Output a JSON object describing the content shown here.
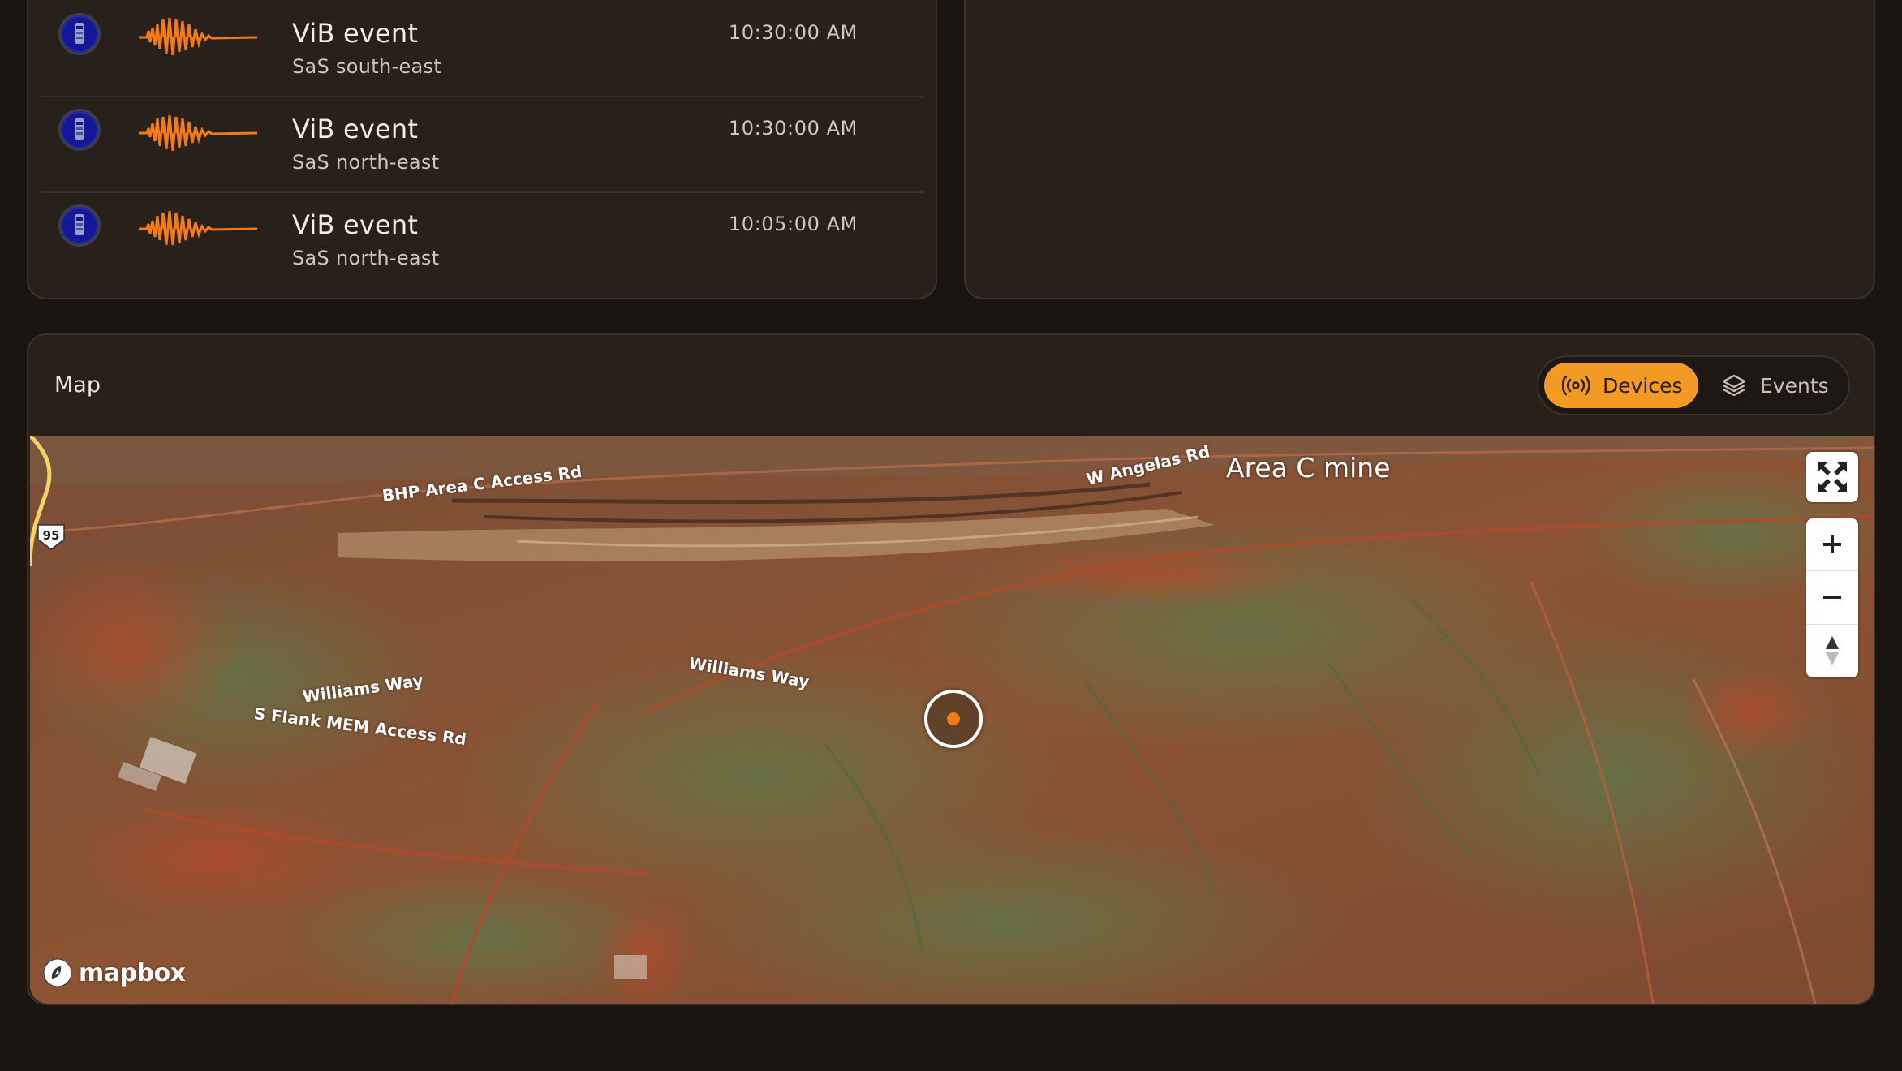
{
  "events": [
    {
      "title": "ViB event",
      "location": "SaS south-east",
      "time": "10:30:00 AM",
      "icon": "device-icon",
      "waveform": "waveform-icon"
    },
    {
      "title": "ViB event",
      "location": "SaS north-east",
      "time": "10:30:00 AM",
      "icon": "device-icon",
      "waveform": "waveform-icon"
    },
    {
      "title": "ViB event",
      "location": "SaS north-east",
      "time": "10:05:00 AM",
      "icon": "device-icon",
      "waveform": "waveform-icon"
    }
  ],
  "map_panel": {
    "title": "Map",
    "toggle": {
      "devices_label": "Devices",
      "events_label": "Events",
      "selected": "Devices",
      "devices_icon": "broadcast-icon",
      "events_icon": "layers-icon"
    }
  },
  "map": {
    "place_label": "Area C mine",
    "road_labels": {
      "bhp": "BHP Area C Access Rd",
      "w_angelas": "W Angelas Rd",
      "williams_way_1": "Williams Way",
      "williams_way_2": "Williams Way",
      "s_flank": "S Flank MEM Access Rd"
    },
    "highway_shield": "95",
    "attribution": "mapbox",
    "controls": [
      "fullscreen-icon",
      "zoom-in-icon",
      "zoom-out-icon",
      "compass-icon"
    ]
  },
  "colors": {
    "accent": "#f39a24",
    "waveform": "#f47a14",
    "device_icon": "#14179a",
    "panel_bg": "#27201b",
    "page_bg": "#1b1512"
  }
}
